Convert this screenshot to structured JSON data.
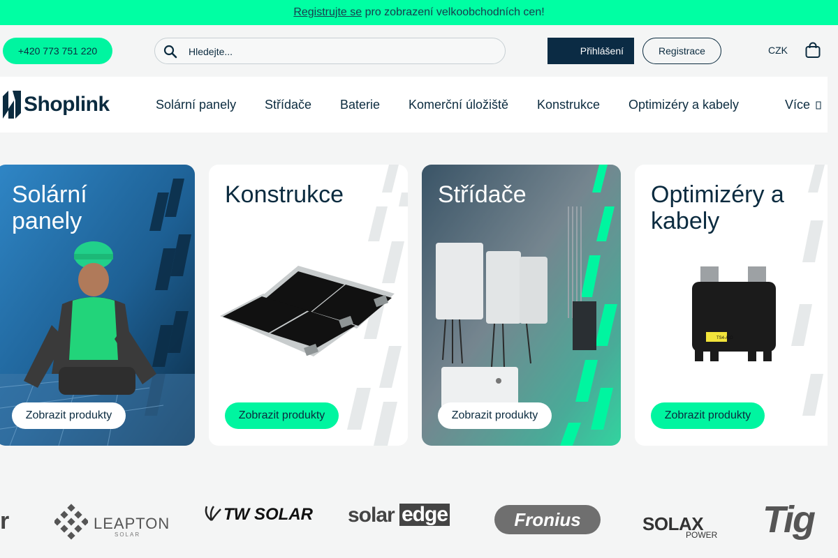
{
  "announcement": {
    "link": "Registrujte se ",
    "text": "pro zobrazení velkoobchodních cen!"
  },
  "header": {
    "phone": "+420 773 751 220",
    "search_placeholder": "Hledejte...",
    "login": "Přihlášení",
    "register": "Registrace",
    "currency": "CZK"
  },
  "brand": {
    "logo_text": "Shoplink"
  },
  "nav": {
    "items": [
      "Solární panely",
      "Střídače",
      "Baterie",
      "Komerční úložiště",
      "Konstrukce",
      "Optimizéry a kabely",
      "Více"
    ]
  },
  "cards": [
    {
      "title_l1": "Solární",
      "title_l2": "panely",
      "button": "Zobrazit produkty"
    },
    {
      "title_l1": "Konstrukce",
      "title_l2": "",
      "button": "Zobrazit produkty"
    },
    {
      "title_l1": "Střídače",
      "title_l2": "",
      "button": "Zobrazit produkty"
    },
    {
      "title_l1": "Optimizéry a",
      "title_l2": "kabely",
      "button": "Zobrazit produkty",
      "label": "TS4-A-O"
    }
  ],
  "brands": {
    "partial_left": "r",
    "leapton": "LEAPTON",
    "leapton_sub": "SOLAR",
    "twsolar": "TW SOLAR",
    "solaredge_a": "solar",
    "solaredge_b": "edge",
    "fronius": "Fronius",
    "solax": "SOLAX",
    "solax_sub": "POWER",
    "tigo": "Tig"
  },
  "colors": {
    "accent": "#00ffa3",
    "navy": "#0b2b44",
    "text": "#0b2b3f"
  }
}
